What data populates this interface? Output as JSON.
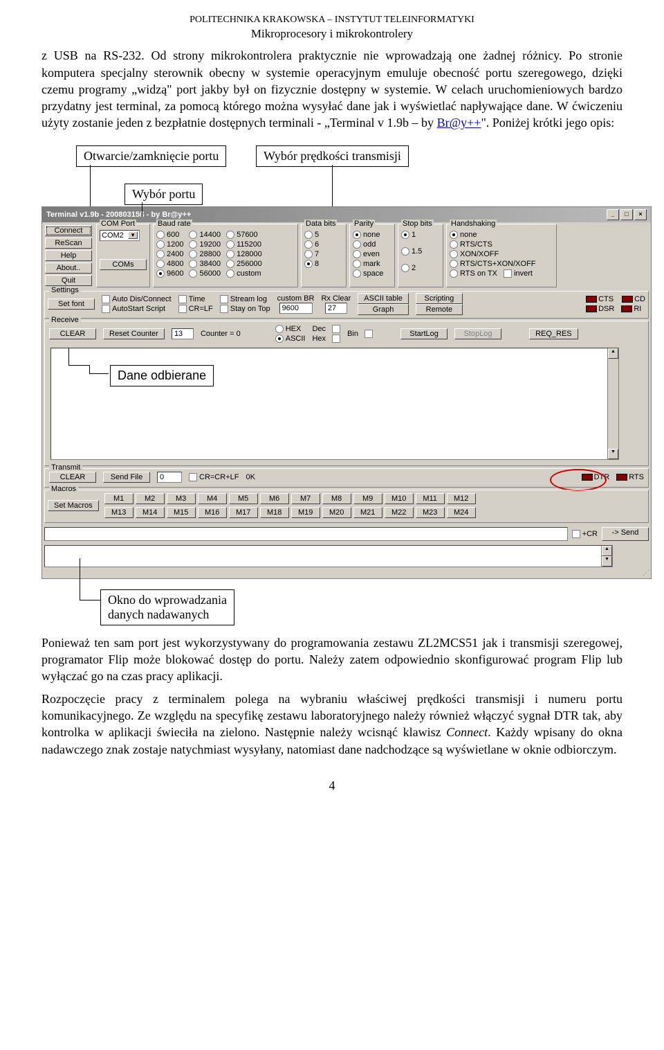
{
  "header": {
    "line1": "POLITECHNIKA KRAKOWSKA – INSTYTUT TELEINFORMATYKI",
    "line2": "Mikroprocesory i mikrokontrolery"
  },
  "para1": "z USB na RS-232. Od strony mikrokontrolera praktycznie nie wprowadzają one żadnej różnicy. Po stronie komputera specjalny sterownik obecny w systemie operacyjnym emuluje obecność portu szeregowego, dzięki czemu programy „widzą\" port jakby był on fizycznie dostępny w systemie. W celach uruchomieniowych bardzo przydatny jest terminal, za pomocą którego można wysyłać dane jak i wyświetlać napływające dane. W ćwiczeniu użyty zostanie jeden z bezpłatnie dostępnych terminali - „Terminal v 1.9b – by ",
  "link_text": "Br@y++",
  "para1b": "\". Poniżej krótki jego opis:",
  "callouts": {
    "c1": "Otwarcie/zamknięcie portu",
    "c2": "Wybór prędkości transmisji",
    "c3": "Wybór portu",
    "c4": "Dane odbierane",
    "c5a": "Okno do wprowadzania",
    "c5b": "danych nadawanych"
  },
  "terminal": {
    "title": "Terminal v1.9b - 20080315ß - by Br@y++",
    "sidebar": [
      "Connect",
      "ReScan",
      "Help",
      "About..",
      "Quit"
    ],
    "com_port": {
      "title": "COM Port",
      "value": "COM2",
      "coms_btn": "COMs"
    },
    "baud": {
      "title": "Baud rate",
      "cols": [
        [
          "600",
          "1200",
          "2400",
          "4800",
          "9600"
        ],
        [
          "14400",
          "19200",
          "28800",
          "38400",
          "56000"
        ],
        [
          "57600",
          "115200",
          "128000",
          "256000",
          "custom"
        ]
      ],
      "selected": "9600"
    },
    "databits": {
      "title": "Data bits",
      "opts": [
        "5",
        "6",
        "7",
        "8"
      ],
      "selected": "8"
    },
    "parity": {
      "title": "Parity",
      "opts": [
        "none",
        "odd",
        "even",
        "mark",
        "space"
      ],
      "selected": "none"
    },
    "stopbits": {
      "title": "Stop bits",
      "opts": [
        "1",
        "1.5",
        "2"
      ],
      "selected": "1"
    },
    "handshake": {
      "title": "Handshaking",
      "opts": [
        "none",
        "RTS/CTS",
        "XON/XOFF",
        "RTS/CTS+XON/XOFF",
        "RTS on TX"
      ],
      "selected": "none",
      "invert": "invert"
    },
    "settings": {
      "title": "Settings",
      "setfont": "Set font",
      "checks": [
        "Auto Dis/Connect",
        "AutoStart Script",
        "Time",
        "CR=LF",
        "Stream log",
        "Stay on Top"
      ],
      "customBR": "custom BR",
      "customBR_v": "9600",
      "rxClear": "Rx Clear",
      "rxClear_v": "27",
      "ascii": "ASCII table",
      "graph": "Graph",
      "scripting": "Scripting",
      "remote": "Remote",
      "leds": [
        "CTS",
        "CD",
        "DSR",
        "RI"
      ]
    },
    "receive": {
      "title": "Receive",
      "clear": "CLEAR",
      "reset": "Reset Counter",
      "counter_v": "13",
      "counter_lbl": "Counter = 0",
      "fmt": [
        "HEX",
        "ASCII",
        "Dec",
        "Hex",
        "Bin"
      ],
      "fmt_sel": "ASCII",
      "startlog": "StartLog",
      "stoplog": "StopLog",
      "reqres": "REQ_RES"
    },
    "transmit": {
      "title": "Transmit",
      "clear": "CLEAR",
      "sendfile": "Send File",
      "spin_v": "0",
      "crlf": "CR=CR+LF",
      "ok": "0K",
      "dtr": "DTR",
      "rts": "RTS"
    },
    "macros": {
      "title": "Macros",
      "set": "Set Macros",
      "row1": [
        "M1",
        "M2",
        "M3",
        "M4",
        "M5",
        "M6",
        "M7",
        "M8",
        "M9",
        "M10",
        "M11",
        "M12"
      ],
      "row2": [
        "M13",
        "M14",
        "M15",
        "M16",
        "M17",
        "M18",
        "M19",
        "M20",
        "M21",
        "M22",
        "M23",
        "M24"
      ]
    },
    "footer": {
      "cr": "+CR",
      "send": "-> Send"
    }
  },
  "para2": "Ponieważ ten sam port jest wykorzystywany do programowania zestawu ZL2MCS51 jak i transmisji szeregowej, programator Flip może blokować dostęp do portu. Należy zatem odpowiednio skonfigurować program Flip lub wyłączać go na czas pracy aplikacji.",
  "para3a": "Rozpoczęcie pracy z terminalem polega na wybraniu właściwej prędkości transmisji i numeru portu komunikacyjnego. Ze względu na specyfikę zestawu laboratoryjnego należy również włączyć sygnał DTR tak, aby kontrolka w aplikacji świeciła na zielono. Następnie należy wcisnąć klawisz ",
  "para3_italic": "Connect",
  "para3b": ". Każdy wpisany do okna nadawczego znak zostaje natychmiast wysyłany, natomiast dane nadchodzące są wyświetlane w oknie odbiorczym.",
  "pagenum": "4"
}
